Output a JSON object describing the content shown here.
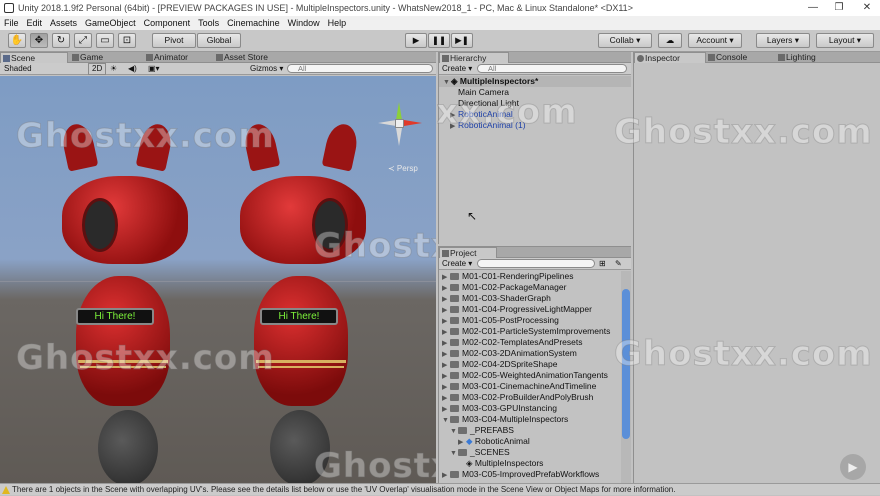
{
  "window": {
    "title": "Unity 2018.1.9f2 Personal (64bit) - [PREVIEW PACKAGES IN USE] - MultipleInspectors.unity - WhatsNew2018_1 - PC, Mac & Linux Standalone* <DX11>",
    "minimize": "—",
    "maximize": "❐",
    "close": "✕"
  },
  "menu": [
    "File",
    "Edit",
    "Assets",
    "GameObject",
    "Component",
    "Tools",
    "Cinemachine",
    "Window",
    "Help"
  ],
  "toolbar": {
    "tools": [
      "hand-icon",
      "move-icon",
      "rotate-icon",
      "scale-icon",
      "rect-icon",
      "transform-icon"
    ],
    "pivot": "Pivot",
    "global": "Global",
    "play": "▶",
    "pause": "❚❚",
    "step": "▶❚",
    "collab": "Collab ▾",
    "cloud": "☁",
    "account": "Account ▾",
    "layers": "Layers ▾",
    "layout": "Layout ▾"
  },
  "scene": {
    "tabs": [
      "Scene",
      "Game",
      "Animator",
      "Asset Store"
    ],
    "shading": "Shaded",
    "mode2d": "2D",
    "gizmos": "Gizmos ▾",
    "search_placeholder": "All",
    "persp": "≺ Persp",
    "robot_labels": [
      "Hi There!",
      "Hi There!"
    ]
  },
  "hierarchy": {
    "tab": "Hierarchy",
    "create": "Create ▾",
    "search_placeholder": "All",
    "scene_name": "MultipleInspectors*",
    "items": [
      "Main Camera",
      "Directional Light",
      "RoboticAnimal",
      "RoboticAnimal (1)"
    ]
  },
  "project": {
    "tab": "Project",
    "create": "Create ▾",
    "folders": [
      "M01-C01-RenderingPipelines",
      "M01-C02-PackageManager",
      "M01-C03-ShaderGraph",
      "M01-C04-ProgressiveLightMapper",
      "M01-C05-PostProcessing",
      "M02-C01-ParticleSystemImprovements",
      "M02-C02-TemplatesAndPresets",
      "M02-C03-2DAnimationSystem",
      "M02-C04-2DSpriteShape",
      "M02-C05-WeightedAnimationTangents",
      "M03-C01-CinemachineAndTimeline",
      "M03-C02-ProBuilderAndPolyBrush",
      "M03-C03-GPUInstancing",
      "M03-C04-MultipleInspectors"
    ],
    "sub1": "_PREFABS",
    "sub1_item": "RoboticAnimal",
    "sub2": "_SCENES",
    "sub2_item": "MultipleInspectors",
    "last": "M03-C05-ImprovedPrefabWorkflows"
  },
  "inspector": {
    "tabs": [
      "Inspector",
      "Console",
      "Lighting"
    ]
  },
  "status": "There are 1 objects in the Scene with overlapping UV's. Please see the details list below or use the 'UV Overlap' visualisation mode in the Scene View or Object Maps for more information.",
  "watermark": "Ghostxx.com"
}
